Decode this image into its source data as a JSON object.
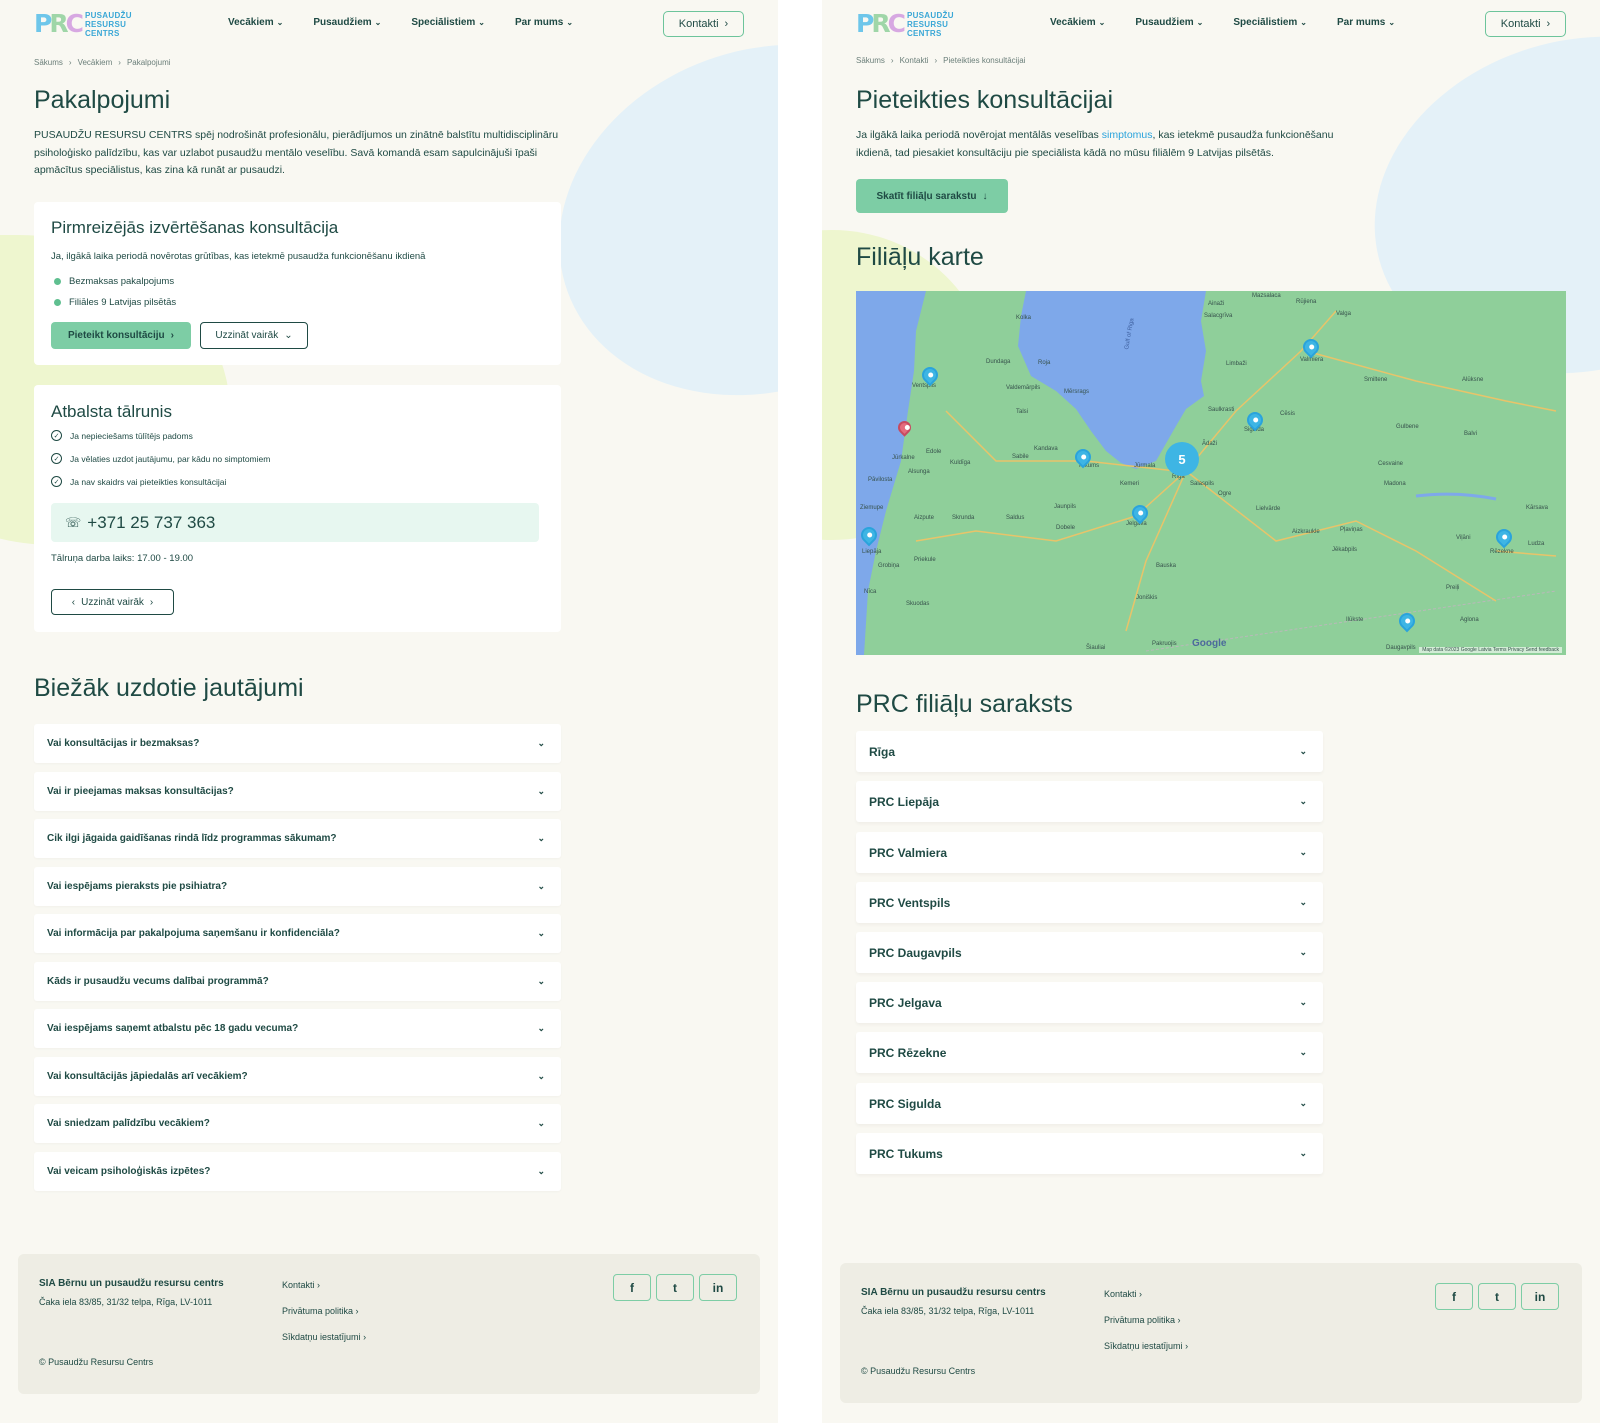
{
  "header": {
    "logo_mark": "PRC",
    "logo_lines": [
      "PUSAUDŽU",
      "RESURSU",
      "CENTRS"
    ],
    "nav": [
      "Vecākiem",
      "Pusaudžiem",
      "Speciālistiem",
      "Par mums"
    ],
    "contact_button": "Kontakti"
  },
  "left": {
    "breadcrumb": [
      "Sākums",
      "Vecākiem",
      "Pakalpojumi"
    ],
    "title": "Pakalpojumi",
    "lead": "PUSAUDŽU RESURSU CENTRS spēj nodrošināt profesionālu, pierādījumos un zinātnē balstītu multidisciplināru psiholoģisko palīdzību, kas var uzlabot pusaudžu mentālo veselību. Savā komandā esam sapulcinājuši īpaši apmācītus speciālistus, kas zina kā runāt ar pusaudzi.",
    "card1": {
      "title": "Pirmreizējās izvērtēšanas konsultācija",
      "subtitle": "Ja, ilgākā laika periodā novērotas grūtības, kas ietekmē pusaudža funkcionēšanu ikdienā",
      "bullets": [
        "Bezmaksas pakalpojums",
        "Filiāles 9 Latvijas pilsētās"
      ],
      "primary_button": "Pieteikt konsultāciju",
      "secondary_button": "Uzzināt vairāk"
    },
    "card2": {
      "title": "Atbalsta tālrunis",
      "checks": [
        "Ja nepieciešams tūlītējs padoms",
        "Ja vēlaties uzdot jautājumu, par kādu no simptomiem",
        "Ja nav skaidrs vai pieteikties konsultācijai"
      ],
      "phone": "+371 25 737 363",
      "hours": "Tālruņa darba laiks: 17.00 - 19.00",
      "button": "Uzzināt vairāk"
    },
    "faq_title": "Biežāk uzdotie jautājumi",
    "faq": [
      "Vai konsultācijas ir bezmaksas?",
      "Vai ir pieejamas maksas konsultācijas?",
      "Cik ilgi jāgaida gaidīšanas rindā līdz programmas sākumam?",
      "Vai iespējams pieraksts pie psihiatra?",
      "Vai informācija par pakalpojuma saņemšanu ir konfidenciāla?",
      "Kāds ir pusaudžu vecums dalībai programmā?",
      "Vai iespējams saņemt atbalstu pēc 18 gadu vecuma?",
      "Vai konsultācijās jāpiedalās arī vecākiem?",
      "Vai sniedzam palīdzību vecākiem?",
      "Vai veicam psiholoģiskās izpētes?"
    ]
  },
  "right": {
    "breadcrumb": [
      "Sākums",
      "Kontakti",
      "Pieteikties konsultācijai"
    ],
    "title": "Pieteikties konsultācijai",
    "lead_before": "Ja ilgākā laika periodā novērojat mentālās veselības ",
    "lead_link": "simptomus",
    "lead_after": ", kas ietekmē pusaudža funkcionēšanu ikdienā, tad piesakiet konsultāciju pie speciālista kādā no mūsu  filiālēm 9 Latvijas pilsētās.",
    "list_button": "Skatīt filiāļu sarakstu",
    "map_title": "Filiāļu karte",
    "map": {
      "cluster_count": "5",
      "labels": [
        "Ventspils",
        "Kolka",
        "Dundaga",
        "Roja",
        "Valdemārpils",
        "Mērsrags",
        "Talsi",
        "Kandava",
        "Sabile",
        "Kuldīga",
        "Aizpute",
        "Skrunda",
        "Saldus",
        "Jaunpils",
        "Dobele",
        "Jelgava",
        "Bauska",
        "Rīga",
        "Jūrmala",
        "Salaspils",
        "Ogre",
        "Lielvārde",
        "Aizkraukle",
        "Pļaviņas",
        "Jēkabpils",
        "Madona",
        "Cesvaine",
        "Gulbene",
        "Balvi",
        "Alūksne",
        "Smiltene",
        "Valmiera",
        "Limbaži",
        "Salacgrīva",
        "Ainaži",
        "Sigulda",
        "Saulkrasti",
        "Ādaži",
        "Cēsis",
        "Rēzekne",
        "Ludza",
        "Kārsava",
        "Viļāni",
        "Preiļi",
        "Daugavpils",
        "Aglona",
        "Ilūkste",
        "Liepāja",
        "Grobiņa",
        "Priekule",
        "Nīca",
        "Skuodas",
        "Šiauliai",
        "Pakruojis",
        "Joniškis",
        "Valga",
        "Rūjiena",
        "Mazsalaca",
        "Pāvilosta",
        "Ziemupe",
        "Alsunga",
        "Edole",
        "Jūrkalne",
        "Gulf of Riga",
        "Tukums",
        "Kemeri"
      ],
      "attribution": "Map data ©2023 Google   Latvia   Terms   Privacy   Send feedback",
      "google": "Google"
    },
    "list_title": "PRC filiāļu saraksts",
    "branches": [
      "Rīga",
      "PRC Liepāja",
      "PRC Valmiera",
      "PRC Ventspils",
      "PRC Daugavpils",
      "PRC Jelgava",
      "PRC Rēzekne",
      "PRC Sigulda",
      "PRC Tukums"
    ]
  },
  "footer": {
    "company": "SIA Bērnu un pusaudžu resursu centrs",
    "address": "Čaka iela 83/85, 31/32 telpa, Rīga, LV-1011",
    "links": [
      "Kontakti",
      "Privātuma politika",
      "Sīkdatņu iestatījumi"
    ],
    "copyright": "© Pusaudžu Resursu Centrs",
    "social": [
      "f",
      "t",
      "in"
    ]
  },
  "colors": {
    "accent": "#7dcda5",
    "text": "#1f4a44",
    "link": "#2aa3dc",
    "page_bg": "#f9f8f2",
    "blob_blue": "#e3f1f8",
    "blob_green": "#eef6cf"
  }
}
